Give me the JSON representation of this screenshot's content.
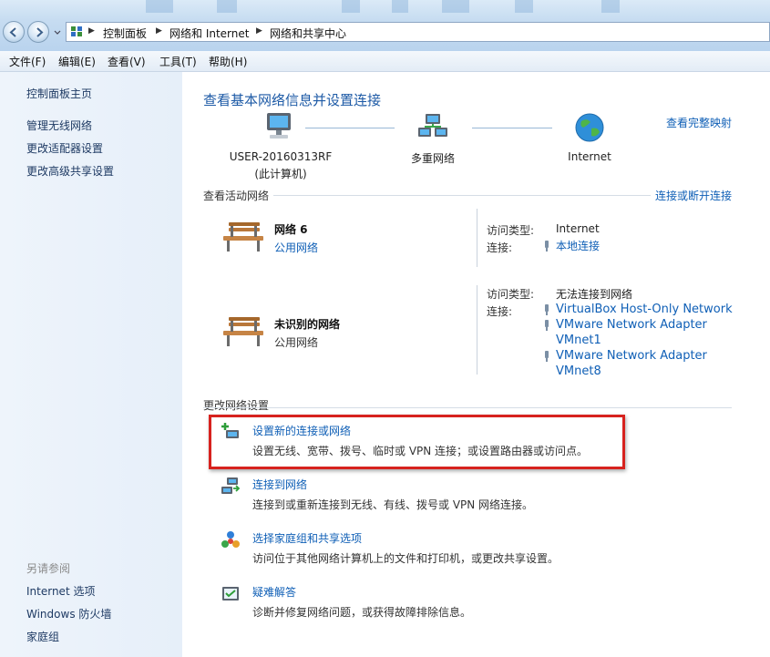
{
  "address": {
    "breadcrumb": [
      "控制面板",
      "网络和 Internet",
      "网络和共享中心"
    ]
  },
  "menu": [
    "文件(F)",
    "编辑(E)",
    "查看(V)",
    "工具(T)",
    "帮助(H)"
  ],
  "left": {
    "tasks": [
      "控制面板主页",
      "管理无线网络",
      "更改适配器设置",
      "更改高级共享设置"
    ],
    "see_also_title": "另请参阅",
    "see_also": [
      "Internet 选项",
      "Windows 防火墙",
      "家庭组"
    ]
  },
  "main": {
    "title": "查看基本网络信息并设置连接",
    "full_map_link": "查看完整映射",
    "map": {
      "computer_name": "USER-20160313RF",
      "computer_sub": "(此计算机)",
      "middle": "多重网络",
      "internet": "Internet"
    },
    "active_section": "查看活动网络",
    "connect_disconnect": "连接或断开连接",
    "networks": [
      {
        "name": "网络  6",
        "type": "公用网络",
        "access_label": "访问类型:",
        "access_value": "Internet",
        "conn_label": "连接:",
        "connections": [
          "本地连接"
        ]
      },
      {
        "name": "未识别的网络",
        "type": "公用网络",
        "access_label": "访问类型:",
        "access_value": "无法连接到网络",
        "conn_label": "连接:",
        "connections": [
          "VirtualBox Host-Only Network",
          "VMware Network Adapter",
          "VMnet1",
          "VMware Network Adapter",
          "VMnet8"
        ]
      }
    ],
    "change_section": "更改网络设置",
    "tasks": [
      {
        "title": "设置新的连接或网络",
        "desc": "设置无线、宽带、拨号、临时或 VPN 连接；或设置路由器或访问点。"
      },
      {
        "title": "连接到网络",
        "desc": "连接到或重新连接到无线、有线、拨号或 VPN 网络连接。"
      },
      {
        "title": "选择家庭组和共享选项",
        "desc": "访问位于其他网络计算机上的文件和打印机，或更改共享设置。"
      },
      {
        "title": "疑难解答",
        "desc": "诊断并修复网络问题，或获得故障排除信息。"
      }
    ]
  }
}
